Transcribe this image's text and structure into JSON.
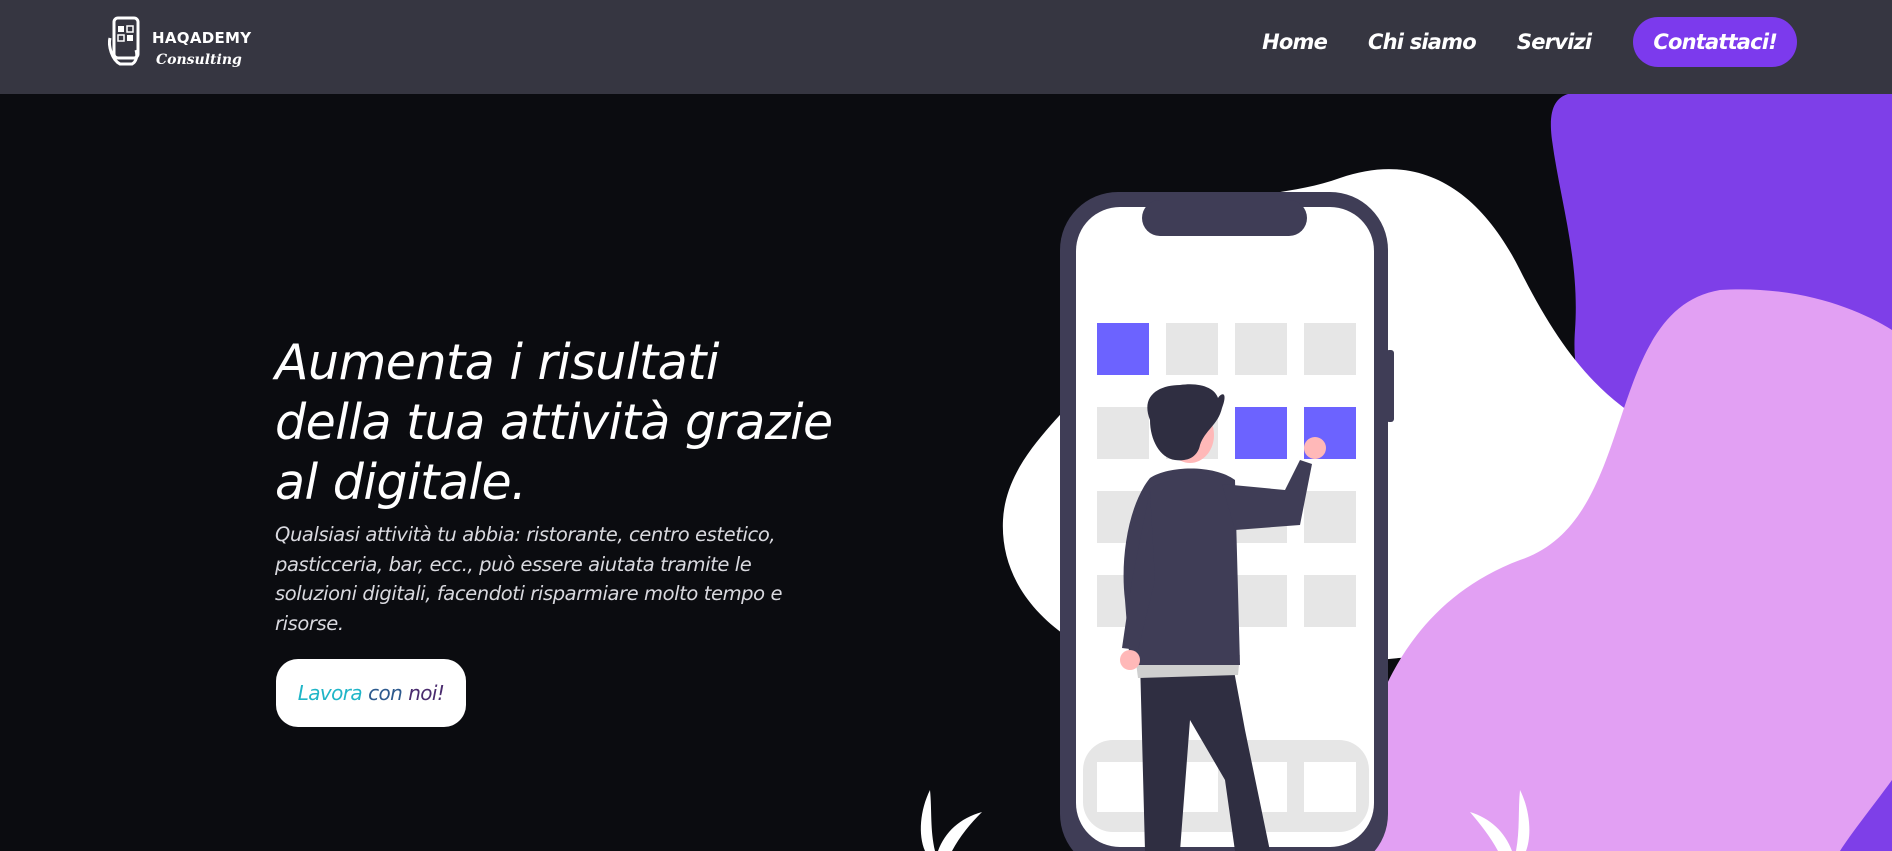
{
  "brand": {
    "title": "HAQADEMY",
    "subtitle": "Consulting",
    "logo_icon": "phone-hand-icon"
  },
  "nav": {
    "items": [
      {
        "label": "Home"
      },
      {
        "label": "Chi siamo"
      },
      {
        "label": "Servizi"
      }
    ],
    "cta_label": "Contattaci!"
  },
  "hero": {
    "title": "Aumenta i risultati della tua attività grazie al digitale.",
    "description": "Qualsiasi attività tu abbia: ristorante, centro estetico, pasticceria, bar, ecc., può essere aiutata tramite le soluzioni digitali, facendoti risparmiare molto tempo e risorse.",
    "button": {
      "word1": "Lavora",
      "word2": "con",
      "word3": "noi!"
    }
  },
  "illustration": {
    "name": "person-tapping-phone-illustration",
    "colors": {
      "blob_purple": "#7e3fe8",
      "blob_lilac": "#e2a0f3",
      "blob_white": "#ffffff",
      "phone_frame": "#3f3d56",
      "tile_active": "#6c63ff",
      "tile_inactive": "#e6e6e6"
    }
  },
  "colors": {
    "header_bg": "#363641",
    "page_bg": "#0b0c10",
    "accent": "#7c3aed"
  }
}
